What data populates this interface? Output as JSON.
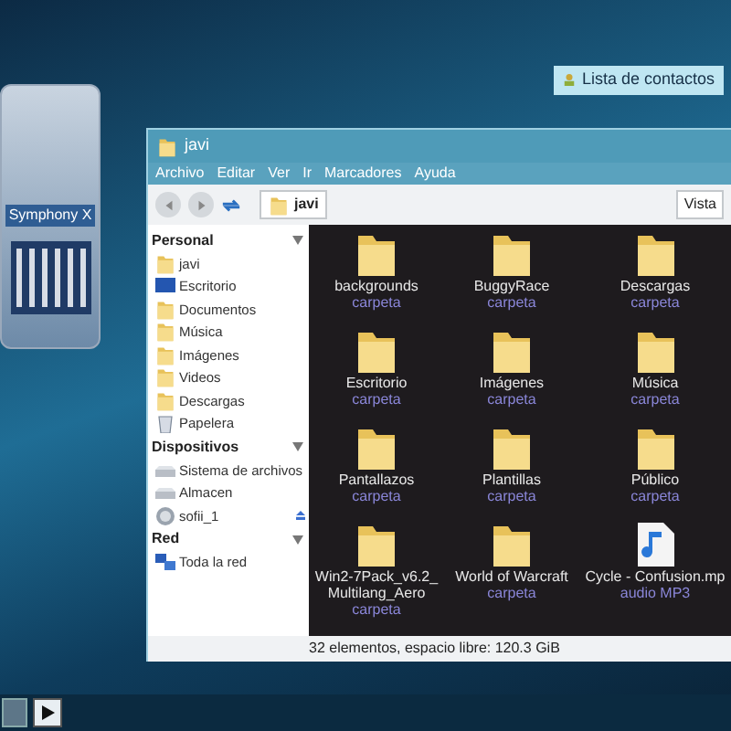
{
  "desktop": {
    "contacts_button": "Lista de contactos",
    "media_player": {
      "track": "Symphony X"
    }
  },
  "window": {
    "title": "javi",
    "menu": [
      "Archivo",
      "Editar",
      "Ver",
      "Ir",
      "Marcadores",
      "Ayuda"
    ],
    "location": "javi",
    "view_button": "Vista",
    "sidebar": [
      {
        "title": "Personal",
        "items": [
          {
            "label": "javi",
            "kind": "folder"
          },
          {
            "label": "Escritorio",
            "kind": "desktop"
          },
          {
            "label": "Documentos",
            "kind": "folder"
          },
          {
            "label": "Música",
            "kind": "folder"
          },
          {
            "label": "Imágenes",
            "kind": "folder"
          },
          {
            "label": "Videos",
            "kind": "folder"
          },
          {
            "label": "Descargas",
            "kind": "folder"
          },
          {
            "label": "Papelera",
            "kind": "trash"
          }
        ]
      },
      {
        "title": "Dispositivos",
        "items": [
          {
            "label": "Sistema de archivos",
            "kind": "drive"
          },
          {
            "label": "Almacen",
            "kind": "drive"
          },
          {
            "label": "sofii_1",
            "kind": "share",
            "eject": true
          }
        ]
      },
      {
        "title": "Red",
        "items": [
          {
            "label": "Toda la red",
            "kind": "network"
          }
        ]
      }
    ],
    "files": [
      {
        "name": "backgrounds",
        "type": "carpeta",
        "kind": "folder"
      },
      {
        "name": "BuggyRace",
        "type": "carpeta",
        "kind": "folder"
      },
      {
        "name": "Descargas",
        "type": "carpeta",
        "kind": "folder"
      },
      {
        "name": "Escritorio",
        "type": "carpeta",
        "kind": "folder"
      },
      {
        "name": "Imágenes",
        "type": "carpeta",
        "kind": "folder"
      },
      {
        "name": "Música",
        "type": "carpeta",
        "kind": "folder"
      },
      {
        "name": "Pantallazos",
        "type": "carpeta",
        "kind": "folder"
      },
      {
        "name": "Plantillas",
        "type": "carpeta",
        "kind": "folder"
      },
      {
        "name": "Público",
        "type": "carpeta",
        "kind": "folder"
      },
      {
        "name": "Win2-7Pack_v6.2_ Multilang_Aero",
        "type": "carpeta",
        "kind": "folder"
      },
      {
        "name": "World of Warcraft",
        "type": "carpeta",
        "kind": "folder"
      },
      {
        "name": "Cycle - Confusion.mp",
        "type": "audio MP3",
        "kind": "audio"
      }
    ],
    "status": "32 elementos, espacio libre: 120.3 GiB"
  }
}
